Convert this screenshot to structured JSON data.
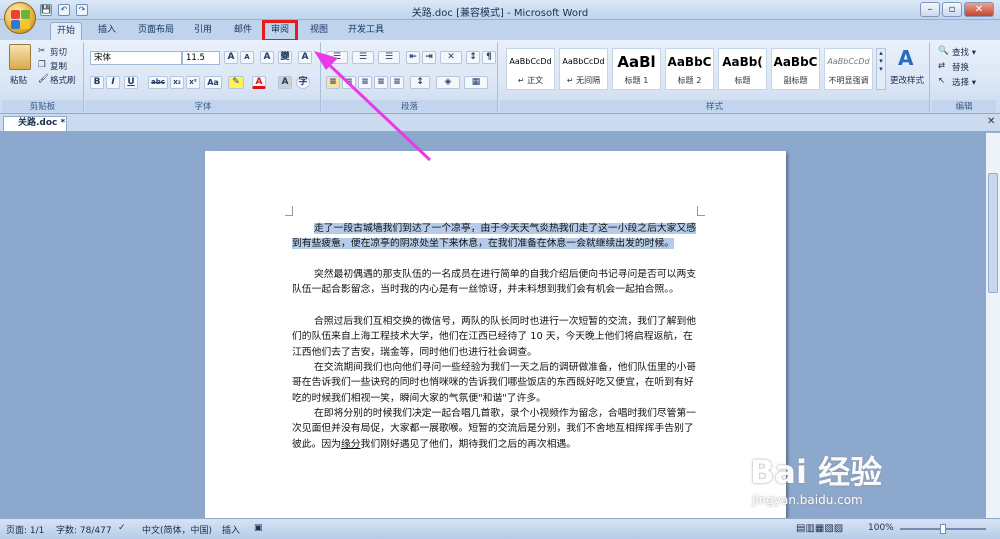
{
  "window": {
    "title": "关路.doc [兼容模式] - Microsoft Word"
  },
  "qat": {
    "save": "💾",
    "undo": "↶",
    "redo": "↷"
  },
  "tabs": [
    {
      "label": "开始"
    },
    {
      "label": "插入"
    },
    {
      "label": "页面布局"
    },
    {
      "label": "引用"
    },
    {
      "label": "邮件"
    },
    {
      "label": "审阅"
    },
    {
      "label": "视图"
    },
    {
      "label": "开发工具"
    }
  ],
  "clipboard": {
    "paste": "粘贴",
    "cut": "剪切",
    "copy": "复制",
    "format_painter": "格式刷",
    "group": "剪贴板"
  },
  "font": {
    "name": "宋体",
    "size": "11.5",
    "group": "字体",
    "bold": "B",
    "italic": "I",
    "underline": "U",
    "strike": "abc",
    "sub": "x₂",
    "sup": "x²",
    "case": "Aa",
    "grow": "A",
    "shrink": "A",
    "clear": "A",
    "phon": "變",
    "border": "A",
    "color_a": "A",
    "shade": "A",
    "encircle": "字"
  },
  "paragraph": {
    "group": "段落"
  },
  "styles": {
    "group": "样式",
    "change": "更改样式",
    "items": [
      {
        "preview": "AaBbCcDd",
        "name": "↵ 正文"
      },
      {
        "preview": "AaBbCcDd",
        "name": "↵ 无间隔"
      },
      {
        "preview": "AaBl",
        "name": "标题 1"
      },
      {
        "preview": "AaBbC",
        "name": "标题 2"
      },
      {
        "preview": "AaBb(",
        "name": "标题"
      },
      {
        "preview": "AaBbC",
        "name": "副标题"
      },
      {
        "preview": "AaBbCcDd",
        "name": "不明显强调"
      }
    ]
  },
  "editing": {
    "find": "查找 ▾",
    "replace": "替换",
    "select": "选择 ▾",
    "group": "编辑"
  },
  "document_tab": {
    "label": "关路.doc *"
  },
  "document": {
    "p1": "走了一段古城墙我们到达了一个凉亭，由于今天天气炎热我们走了这一小段之后大家又感到有些疲惫，便在凉亭的阴凉处坐下来休息，在我们准备在休息一会就继续出发的时候。",
    "p2": "突然最初偶遇的那支队伍的一名成员在进行简单的自我介绍后便向书记寻问是否可以两支队伍一起合影留念，当时我的内心是有一丝惊讶，并未料想到我们会有机会一起拍合照。。",
    "p3": "合照过后我们互相交换的微信号，两队的队长同时也进行一次短暂的交流，我们了解到他们的队伍来自上海工程技术大学，他们在江西已经待了 10 天，今天晚上他们将启程返航，在江西他们去了吉安，瑞金等，同时他们也进行社会调查。",
    "p4": "在交流期间我们也向他们寻问一些经验为我们一天之后的调研做准备，他们队伍里的小哥哥在告诉我们一些诀窍的同时也悄咪咪的告诉我们哪些饭店的东西既好吃又便宜，在听到有好吃的时候我们相视一笑，瞬间大家的气氛便\"和谐\"了许多。",
    "p5a": "在即将分别的时候我们决定一起合唱几首歌，录个小视频作为留念，合唱时我们尽管第一次见面但并没有局促，大家都一展歌喉。短暂的交流后是分别，我们不舍地互相挥挥手告别了彼此。因为",
    "p5link": "缘分",
    "p5b": "我们刚好遇见了他们，期待我们之后的再次相遇。"
  },
  "status": {
    "page": "页面: 1/1",
    "words": "字数: 78/477",
    "lang": "中文(简体，中国)",
    "mode": "插入",
    "zoom": "100%"
  },
  "watermark": {
    "brand": "Bai 经验",
    "url": "jingyan.baidu.com"
  },
  "colors": {
    "highlight_red": "#e21d1d",
    "arrow_magenta": "#e83ae8",
    "selection": "#b5cce8"
  }
}
